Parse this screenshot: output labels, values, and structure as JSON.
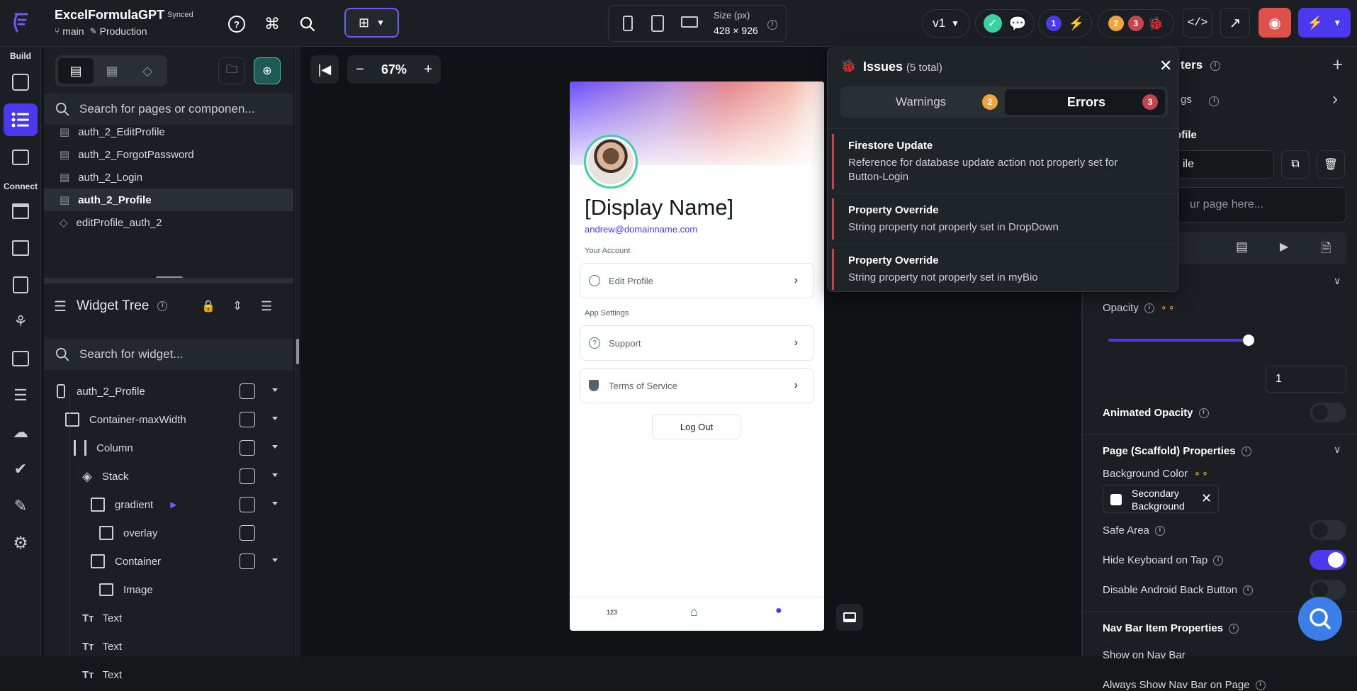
{
  "app": {
    "name": "ExcelFormulaGPT",
    "sync_status": "Synced",
    "branch": "main",
    "environment": "Production"
  },
  "toolbar": {
    "size_label": "Size (px)",
    "size_value": "428 × 926",
    "version": "v1",
    "warnings_count": "2",
    "errors_count": "3",
    "info_count": "1"
  },
  "rail": {
    "build_label": "Build",
    "connect_label": "Connect"
  },
  "pages": {
    "search_placeholder": "Search for pages or componen...",
    "items": [
      {
        "label": "auth_2_EditProfile",
        "icon": "page-icon"
      },
      {
        "label": "auth_2_ForgotPassword",
        "icon": "page-icon"
      },
      {
        "label": "auth_2_Login",
        "icon": "page-icon"
      },
      {
        "label": "auth_2_Profile",
        "icon": "page-icon",
        "selected": true
      },
      {
        "label": "editProfile_auth_2",
        "icon": "component-icon"
      }
    ]
  },
  "widget_tree": {
    "title": "Widget Tree",
    "search_placeholder": "Search for widget...",
    "nodes": [
      {
        "label": "auth_2_Profile",
        "icon": "phone-icon"
      },
      {
        "label": "Container-maxWidth",
        "icon": "container-icon"
      },
      {
        "label": "Column",
        "icon": "column-icon"
      },
      {
        "label": "Stack",
        "icon": "stack-icon"
      },
      {
        "label": "gradient",
        "icon": "container-icon"
      },
      {
        "label": "overlay",
        "icon": "container-icon"
      },
      {
        "label": "Container",
        "icon": "container-icon"
      },
      {
        "label": "Image",
        "icon": "image-icon"
      },
      {
        "label": "Text",
        "icon": "text-icon"
      },
      {
        "label": "Text",
        "icon": "text-icon"
      },
      {
        "label": "Text",
        "icon": "text-icon"
      }
    ]
  },
  "canvas": {
    "zoom": "67%"
  },
  "phone": {
    "display_name": "[Display Name]",
    "email": "andrew@domainname.com",
    "your_account_label": "Your Account",
    "edit_profile_label": "Edit Profile",
    "app_settings_label": "App Settings",
    "support_label": "Support",
    "terms_label": "Terms of Service",
    "logout_label": "Log Out",
    "nav_first": "123"
  },
  "issues": {
    "title": "Issues",
    "total": "(5 total)",
    "warnings_tab": "Warnings",
    "warnings_count": "2",
    "errors_tab": "Errors",
    "errors_count": "3",
    "items": [
      {
        "title": "Firestore Update",
        "desc": "Reference for database update action not properly set for Button-Login"
      },
      {
        "title": "Property Override",
        "desc": "String property not properly set in DropDown"
      },
      {
        "title": "Property Override",
        "desc": "String property not properly set in myBio"
      }
    ]
  },
  "right_panel": {
    "header_partial": "ters",
    "settings_partial": "gs",
    "page_name_label_partial": "ofile",
    "page_name_value_partial": "ile",
    "description_placeholder_partial": "ur page here...",
    "opacity_label": "Opacity",
    "opacity_value": "1",
    "opacity_level": 1.0,
    "animated_opacity_label": "Animated Opacity",
    "scaffold_title": "Page (Scaffold) Properties",
    "bg_color_label": "Background Color",
    "bg_color_value": "Secondary Background",
    "safe_area_label": "Safe Area",
    "hide_keyboard_label": "Hide Keyboard on Tap",
    "disable_back_label": "Disable Android Back Button",
    "navbar_title": "Nav Bar Item Properties",
    "show_navbar_label": "Show on Nav Bar",
    "always_show_navbar_label": "Always Show Nav Bar on Page"
  },
  "colors": {
    "accent": "#4b39ef",
    "warning": "#f0a43a",
    "error": "#c4454d",
    "success": "#39d2a0"
  }
}
